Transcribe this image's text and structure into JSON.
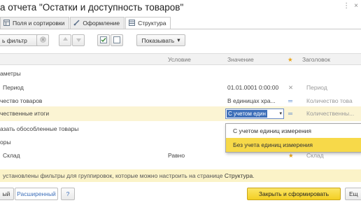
{
  "window": {
    "title": "а отчета \"Остатки и доступность товаров\"",
    "menu_glyph": "⋮",
    "close_glyph": "×"
  },
  "tabs": [
    {
      "label": "Поля и сортировки",
      "icon": "fields-icon"
    },
    {
      "label": "Оформление",
      "icon": "brush-icon"
    },
    {
      "label": "Структура",
      "icon": "structure-icon"
    }
  ],
  "toolbar": {
    "filter_label": "ь фильтр",
    "show_label": "Показывать",
    "show_arrow": "▾"
  },
  "columns": {
    "condition": "Условие",
    "value": "Значение",
    "title": "Заголовок",
    "flag_glyph": "★"
  },
  "rows": [
    {
      "name": "аметры",
      "condition": "",
      "value": "",
      "mark": "",
      "title": ""
    },
    {
      "name": "Период",
      "condition": "",
      "value": "01.01.0001 0:00:00",
      "mark": "✕",
      "title": "Период"
    },
    {
      "name": "чество товаров",
      "condition": "",
      "value": "В единицах хра...",
      "mark": "═",
      "title": "Количество това"
    },
    {
      "name": "чественные итоги",
      "condition": "",
      "value": "",
      "mark": "═",
      "title": "Количественны..."
    },
    {
      "name": "азать обособленные товары",
      "condition": "",
      "value": "",
      "mark": "",
      "title": ""
    },
    {
      "name": "оры",
      "condition": "",
      "value": "",
      "mark": "",
      "title": ""
    },
    {
      "name": "Склад",
      "condition": "Равно",
      "value": "",
      "mark": "★",
      "title": "Склад"
    }
  ],
  "combo": {
    "value": "С учетом един",
    "arrow": "▾"
  },
  "dropdown": {
    "options": [
      "С учетом единиц измерения",
      "Без учета единиц измерения"
    ],
    "selected_index": 1
  },
  "infobar": {
    "text": " установлены фильтры для группировок, которые можно настроить на странице ",
    "link": "Структура",
    "end": "."
  },
  "footer": {
    "simple_label": "ый",
    "advanced_label": "Расширенный",
    "question_label": "?",
    "generate_label": "Закрыть и сформировать",
    "extra_label": "Ещ"
  },
  "colors": {
    "accent_yellow": "#f3cf23",
    "selection_bg": "#fbf4d3",
    "info_bg": "#fbf3c8",
    "star": "#e8a317",
    "pen_blue": "#4a7cc9"
  }
}
